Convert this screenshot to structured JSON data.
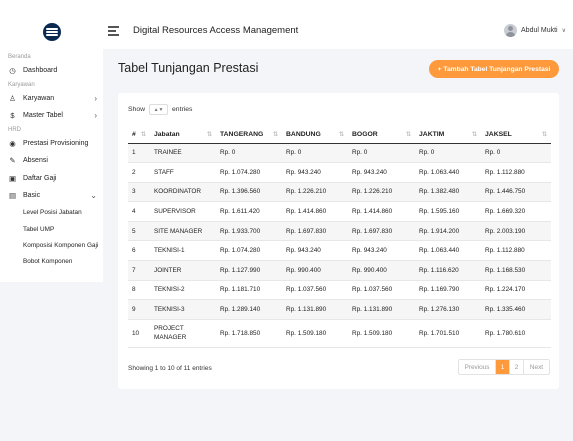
{
  "header": {
    "title": "Digital Resources Access Management",
    "user_name": "Abdul Mukti"
  },
  "sidebar": {
    "sections": [
      {
        "label": "Beranda",
        "items": [
          {
            "label": "Dashboard",
            "icon": "dashboard-icon"
          }
        ]
      },
      {
        "label": "Karyawan",
        "items": [
          {
            "label": "Karyawan",
            "icon": "person-icon",
            "expandable": true
          },
          {
            "label": "Master Tabel",
            "icon": "dollar-icon",
            "expandable": true
          }
        ]
      },
      {
        "label": "HRD",
        "items": [
          {
            "label": "Prestasi Provisioning",
            "icon": "circle-icon"
          },
          {
            "label": "Absensi",
            "icon": "edit-icon"
          },
          {
            "label": "Daftar Gaji",
            "icon": "money-icon"
          },
          {
            "label": "Basic",
            "icon": "database-icon",
            "expanded": true
          }
        ]
      }
    ],
    "basic_subitems": [
      "Level Posisi Jabatan",
      "Tabel UMP",
      "Komposisi Komponen Gaji",
      "Bobot Komponen"
    ]
  },
  "page": {
    "title": "Tabel Tunjangan Prestasi",
    "add_button": "+ Tambah Tabel Tunjangan Prestasi"
  },
  "table_controls": {
    "show_label": "Show",
    "show_value": "▲▼",
    "entries_label": "entries"
  },
  "table": {
    "columns": [
      "#",
      "Jabatan",
      "TANGERANG",
      "BANDUNG",
      "BOGOR",
      "JAKTIM",
      "JAKSEL"
    ],
    "rows": [
      [
        "1",
        "TRAINEE",
        "Rp. 0",
        "Rp. 0",
        "Rp. 0",
        "Rp. 0",
        "Rp. 0"
      ],
      [
        "2",
        "STAFF",
        "Rp. 1.074.280",
        "Rp. 943.240",
        "Rp. 943.240",
        "Rp. 1.063.440",
        "Rp. 1.112.880"
      ],
      [
        "3",
        "KOORDINATOR",
        "Rp. 1.396.560",
        "Rp. 1.226.210",
        "Rp. 1.226.210",
        "Rp. 1.382.480",
        "Rp. 1.446.750"
      ],
      [
        "4",
        "SUPERVISOR",
        "Rp. 1.611.420",
        "Rp. 1.414.860",
        "Rp. 1.414.860",
        "Rp. 1.595.160",
        "Rp. 1.669.320"
      ],
      [
        "5",
        "SITE MANAGER",
        "Rp. 1.933.700",
        "Rp. 1.697.830",
        "Rp. 1.697.830",
        "Rp. 1.914.200",
        "Rp. 2.003.190"
      ],
      [
        "6",
        "TEKNISI-1",
        "Rp. 1.074.280",
        "Rp. 943.240",
        "Rp. 943.240",
        "Rp. 1.063.440",
        "Rp. 1.112.880"
      ],
      [
        "7",
        "JOINTER",
        "Rp. 1.127.990",
        "Rp. 990.400",
        "Rp. 990.400",
        "Rp. 1.116.620",
        "Rp. 1.168.530"
      ],
      [
        "8",
        "TEKNISI-2",
        "Rp. 1.181.710",
        "Rp. 1.037.560",
        "Rp. 1.037.560",
        "Rp. 1.169.790",
        "Rp. 1.224.170"
      ],
      [
        "9",
        "TEKNISI-3",
        "Rp. 1.289.140",
        "Rp. 1.131.890",
        "Rp. 1.131.890",
        "Rp. 1.276.130",
        "Rp. 1.335.460"
      ],
      [
        "10",
        "PROJECT MANAGER",
        "Rp. 1.718.850",
        "Rp. 1.509.180",
        "Rp. 1.509.180",
        "Rp. 1.701.510",
        "Rp. 1.780.610"
      ]
    ]
  },
  "footer": {
    "info": "Showing 1 to 10 of 11 entries",
    "previous": "Previous",
    "pages": [
      "1",
      "2"
    ],
    "active_page": "1",
    "next": "Next"
  },
  "colors": {
    "accent": "#ff9a3c",
    "logo": "#0b2a52"
  }
}
